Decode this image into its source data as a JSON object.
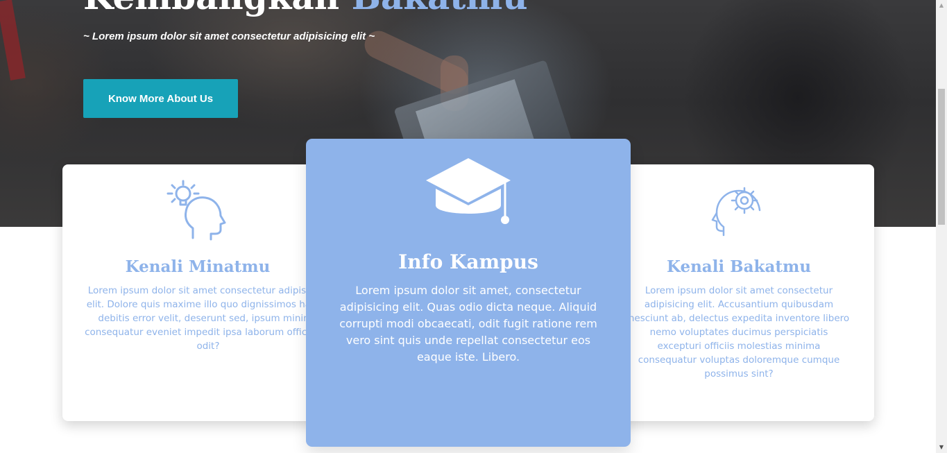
{
  "hero": {
    "title_main": "Kembangkan ",
    "title_accent": "Bakatmu",
    "subtitle": "~ Lorem ipsum dolor sit amet consectetur adipisicing elit ~",
    "cta_label": "Know More About Us"
  },
  "cards": [
    {
      "icon": "idea-head-icon",
      "title": "Kenali Minatmu",
      "text": "Lorem ipsum dolor sit amet consectetur adipisicing elit. Dolore quis maxime illo quo dignissimos harum debitis error velit, deserunt sed, ipsum minima consequatur eveniet impedit ipsa laborum officiis ad odit?"
    },
    {
      "icon": "graduation-cap-icon",
      "title": "Info Kampus",
      "text": "Lorem ipsum dolor sit amet, consectetur adipisicing elit. Quas odio dicta neque. Aliquid corrupti modi obcaecati, odit fugit ratione rem vero sint quis unde repellat consectetur eos eaque iste. Libero."
    },
    {
      "icon": "gear-head-icon",
      "title": "Kenali Bakatmu",
      "text": "Lorem ipsum dolor sit amet consectetur adipisicing elit. Accusantium quibusdam nesciunt ab, delectus expedita inventore libero nemo voluptates ducimus perspiciatis excepturi officiis molestias minima consequatur voluptas doloremque cumque possimus sint?"
    }
  ],
  "colors": {
    "accent": "#8eb3ea",
    "cta": "#17a2b8",
    "hero_overlay": "#333335"
  }
}
